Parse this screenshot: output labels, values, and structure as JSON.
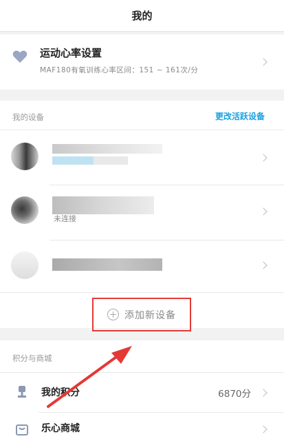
{
  "header": {
    "title": "我的"
  },
  "heart_rate": {
    "title": "运动心率设置",
    "subtitle": "MAF180有氧训练心率区间：151 ~ 161次/分"
  },
  "devices": {
    "section_title": "我的设备",
    "change_link": "更改活跃设备",
    "partial_status": "未连接",
    "add_label": "添加新设备"
  },
  "points_mall": {
    "section_title": "积分与商城",
    "points_label": "我的积分",
    "points_value": "6870分",
    "mall_label": "乐心商城"
  },
  "colors": {
    "accent": "#1a9fe0",
    "highlight": "#e53935",
    "heart": "#9aa6c4"
  },
  "icons": [
    "heart-icon",
    "plus-icon",
    "trophy-icon",
    "mall-icon",
    "chevron-right-icon"
  ]
}
